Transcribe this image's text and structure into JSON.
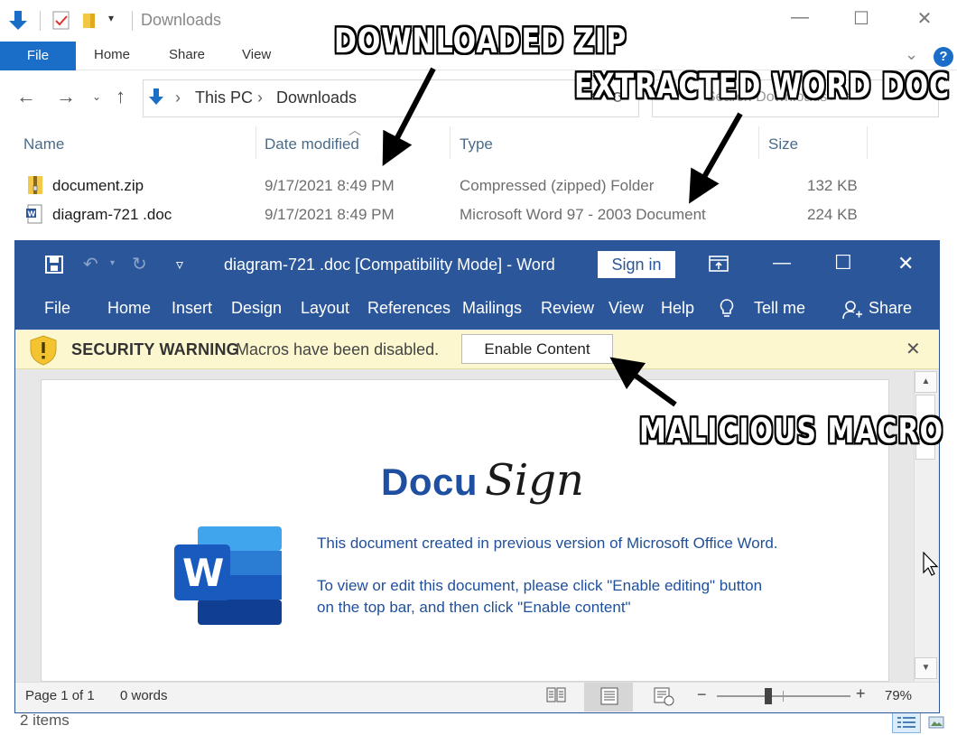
{
  "explorer": {
    "title": "Downloads",
    "ribbon_tabs": [
      "File",
      "Home",
      "Share",
      "View"
    ],
    "address": {
      "this_pc": "This PC",
      "downloads": "Downloads"
    },
    "search_placeholder": "Search Downloads",
    "columns": [
      "Name",
      "Date modified",
      "Type",
      "Size"
    ],
    "files": [
      {
        "name": "document.zip",
        "date": "9/17/2021 8:49 PM",
        "type": "Compressed (zipped) Folder",
        "size": "132 KB"
      },
      {
        "name": "diagram-721 .doc",
        "date": "9/17/2021 8:49 PM",
        "type": "Microsoft Word 97 - 2003 Document",
        "size": "224 KB"
      }
    ],
    "status": "2 items"
  },
  "word": {
    "title": "diagram-721 .doc [Compatibility Mode]  -  Word",
    "sign_in": "Sign in",
    "menu": [
      "File",
      "Home",
      "Insert",
      "Design",
      "Layout",
      "References",
      "Mailings",
      "Review",
      "View",
      "Help",
      "Tell me",
      "Share"
    ],
    "security": {
      "title": "SECURITY WARNING",
      "message": "Macros have been disabled.",
      "button": "Enable Content"
    },
    "doc": {
      "brand_docu": "Docu",
      "brand_sign": "Sign",
      "line1": "This document created in previous version of Microsoft Office Word.",
      "line2": "To view or edit this document, please click \"Enable editing\" button",
      "line3": "on the top bar, and then click \"Enable content\"",
      "word_icon_letter": "W"
    },
    "status": {
      "page": "Page 1 of 1",
      "words": "0 words",
      "zoom": "79%"
    }
  },
  "annotations": {
    "zip": "DOWNLOADED ZIP",
    "doc": "EXTRACTED WORD DOC",
    "macro": "MALICIOUS MACRO"
  },
  "colors": {
    "word_blue": "#2b579a",
    "explorer_blue": "#1a6ec7",
    "warning_yellow": "#fcf7cf"
  }
}
